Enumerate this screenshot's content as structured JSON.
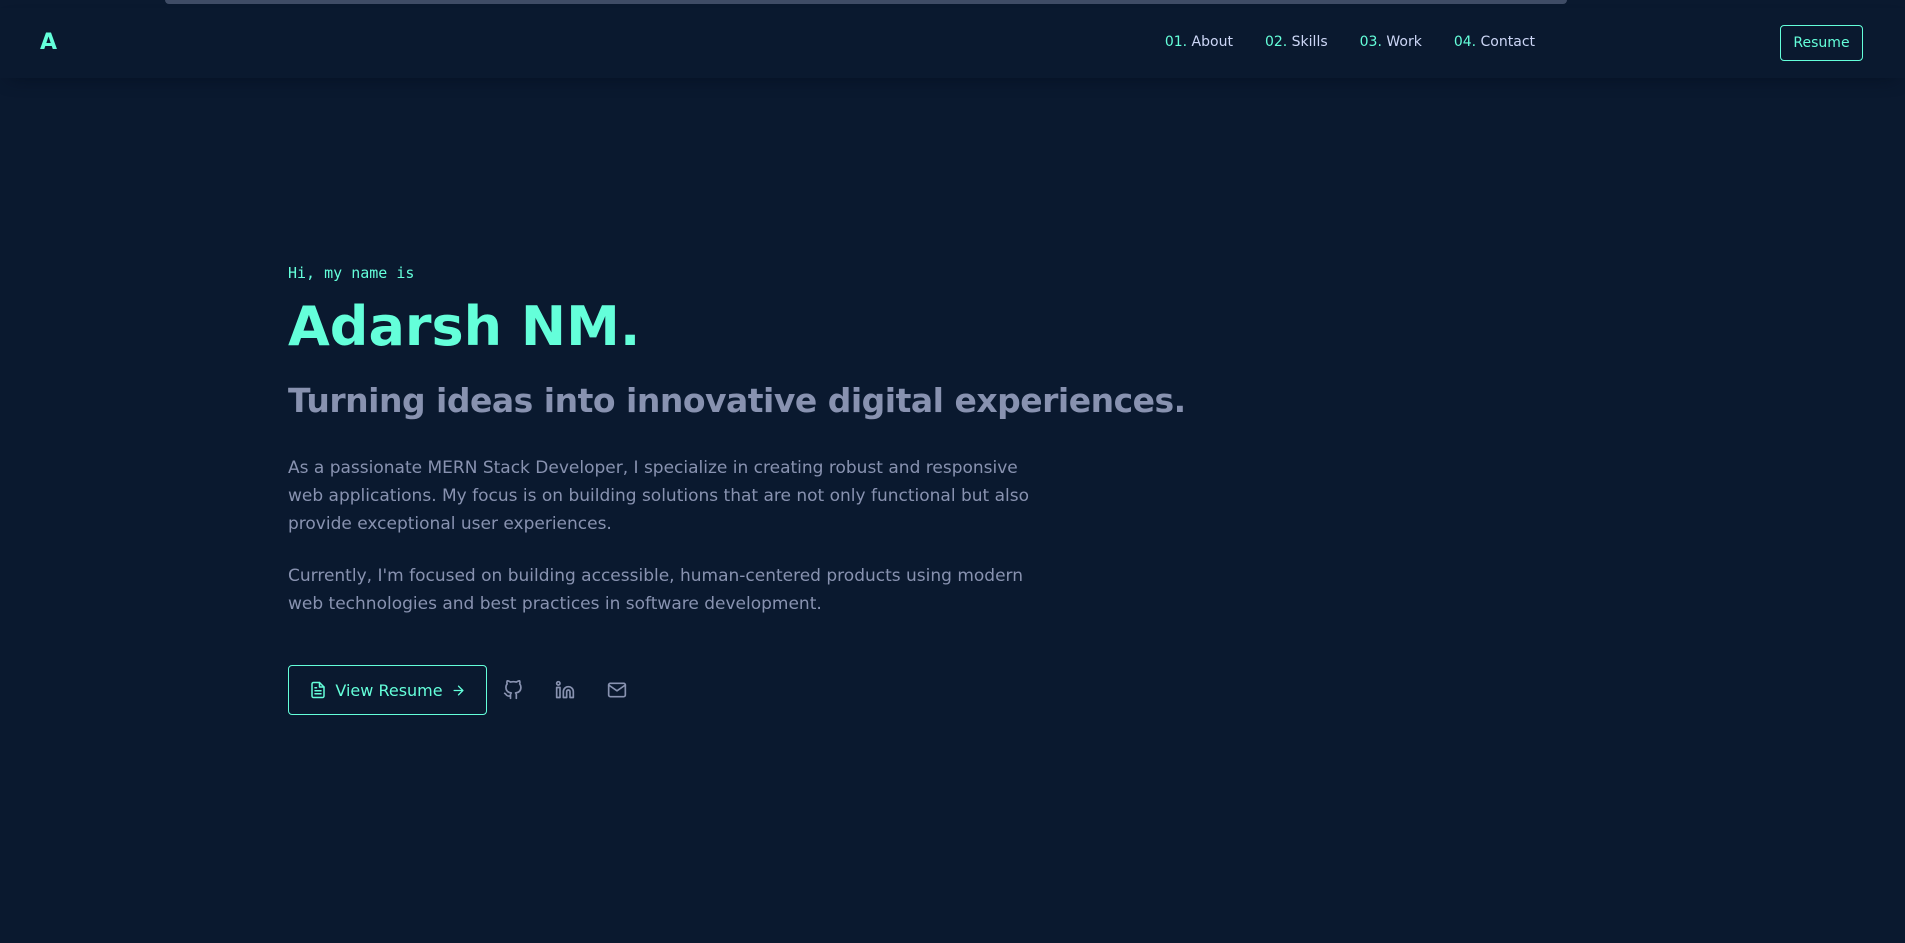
{
  "header": {
    "logo": "A",
    "nav": [
      {
        "num": "01.",
        "label": "About"
      },
      {
        "num": "02.",
        "label": "Skills"
      },
      {
        "num": "03.",
        "label": "Work"
      },
      {
        "num": "04.",
        "label": "Contact"
      }
    ],
    "resume_label": "Resume"
  },
  "hero": {
    "greeting": "Hi, my name is",
    "name": "Adarsh NM.",
    "tagline": "Turning ideas into innovative digital experiences.",
    "bio": [
      "As a passionate MERN Stack Developer, I specialize in creating robust and responsive web applications. My focus is on building solutions that are not only functional but also provide exceptional user experiences.",
      "Currently, I'm focused on building accessible, human-centered products using modern web technologies and best practices in software development."
    ],
    "view_resume_label": "View Resume",
    "icons": {
      "resume": "file-text-icon",
      "arrow": "arrow-right-icon",
      "github": "github-icon",
      "linkedin": "linkedin-icon",
      "email": "mail-icon"
    }
  },
  "colors": {
    "background": "#0a192f",
    "accent": "#64ffda",
    "text_light": "#ccd6f6",
    "text_muted": "#8892b0"
  }
}
